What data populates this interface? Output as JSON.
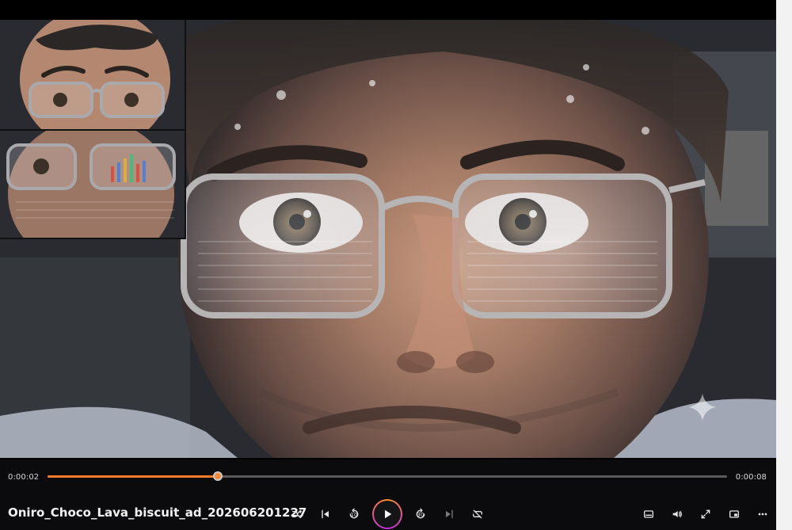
{
  "player": {
    "title": "Onirо_Choco_Lava_biscuit_ad_202606201227",
    "current_time": "0:00:02",
    "total_time": "0:00:08",
    "progress": 0.25
  },
  "colors": {
    "accent": "#ff7a2a",
    "play_ring_start": "#ff8c2a",
    "play_ring_end": "#c12ae8"
  },
  "controls": {
    "left": [
      {
        "name": "shuffle-button",
        "icon": "shuffle-icon"
      },
      {
        "name": "previous-button",
        "icon": "skip-previous-icon"
      },
      {
        "name": "skip-back-10-button",
        "icon": "rewind-10-icon",
        "label": "10"
      },
      {
        "name": "play-button",
        "icon": "play-icon"
      },
      {
        "name": "skip-forward-30-button",
        "icon": "forward-30-icon",
        "label": "30"
      },
      {
        "name": "next-button",
        "icon": "skip-next-icon"
      },
      {
        "name": "repeat-button",
        "icon": "repeat-off-icon"
      }
    ],
    "right": [
      {
        "name": "captions-button",
        "icon": "subtitles-icon"
      },
      {
        "name": "volume-button",
        "icon": "volume-icon"
      },
      {
        "name": "fullscreen-button",
        "icon": "fullscreen-icon"
      },
      {
        "name": "mini-player-button",
        "icon": "mini-player-icon"
      },
      {
        "name": "more-options-button",
        "icon": "more-icon"
      }
    ]
  }
}
